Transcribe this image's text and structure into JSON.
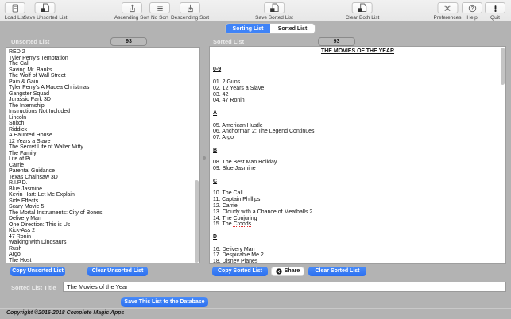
{
  "toolbar": {
    "items": [
      {
        "label": "Load List"
      },
      {
        "label": "Save Unsorted List"
      },
      {
        "label": "Ascending Sort"
      },
      {
        "label": "No Sort"
      },
      {
        "label": "Descending Sort"
      },
      {
        "label": "Save Sorted List"
      },
      {
        "label": "Clear Both List"
      },
      {
        "label": "Preferences"
      },
      {
        "label": "Help"
      },
      {
        "label": "Quit"
      }
    ]
  },
  "tabs": {
    "items": [
      "Sorting List",
      "Sorted List"
    ],
    "active_index": 0
  },
  "unsorted_panel": {
    "label": "Unsorted List",
    "count": "93",
    "items": [
      "RED 2",
      "Tyler Perry's Temptation",
      "The Call",
      "Saving Mr. Banks",
      "The Wolf of Wall Street",
      "Pain & Gain",
      "Tyler Perry's A Madea Christmas",
      "Gangster Squad",
      "Jurassic Park 3D",
      "The Internship",
      "Instructions Not Included",
      "Lincoln",
      "Snitch",
      "Riddick",
      "A Haunted House",
      "12 Years a Slave",
      "The Secret Life of Walter Mitty",
      "The Family",
      "Life of Pi",
      "Carrie",
      "Parental Guidance",
      "Texas Chainsaw 3D",
      "R.I.P.D.",
      "Blue Jasmine",
      "Kevin Hart: Let Me Explain",
      "Side Effects",
      "Scary Movie 5",
      "The Mortal Instruments: City of Bones",
      "Delivery Man",
      "One Direction: This is Us",
      "Kick-Ass 2",
      "47 Ronin",
      "Walking with Dinosaurs",
      "Rush",
      "Argo",
      "The Host"
    ],
    "buttons": {
      "copy": "Copy Unsorted List",
      "clear": "Clear Unsorted List"
    }
  },
  "sorted_panel": {
    "label": "Sorted List",
    "count": "93",
    "title": "THE MOVIES OF THE YEAR",
    "sections": [
      {
        "heading": "0-9",
        "items": [
          "01. 2 Guns",
          "02. 12 Years a Slave",
          "03. 42",
          "04. 47 Ronin"
        ]
      },
      {
        "heading": "A",
        "items": [
          "05. American Hustle",
          "06. Anchorman 2: The Legend Continues",
          "07. Argo"
        ]
      },
      {
        "heading": "B",
        "items": [
          "08. The Best Man Holiday",
          "09. Blue Jasmine"
        ]
      },
      {
        "heading": "C",
        "items": [
          "10. The Call",
          "11. Captain Phillips",
          "12. Carrie",
          "13. Cloudy with a Chance of Meatballs 2",
          "14. The Conjuring",
          "15. The Croods"
        ]
      },
      {
        "heading": "D",
        "items": [
          "16. Delivery Man",
          "17. Despicable Me 2",
          "18. Disney Planes"
        ]
      }
    ],
    "buttons": {
      "copy": "Copy Sorted List",
      "share": "Share",
      "clear": "Clear Sorted List"
    }
  },
  "title_field": {
    "label": "Sorted List Title",
    "value": "The Movies of the Year"
  },
  "save_button_label": "Save This List to the Database",
  "footer": "Copyright ©2016-2018 Complete Magic Apps",
  "spellcheck_words": [
    "Madea",
    "Host",
    "Croods"
  ],
  "colors": {
    "accent": "#2b6ff0",
    "selected_tab": "#3f83f7",
    "misspell": "#e03030"
  }
}
